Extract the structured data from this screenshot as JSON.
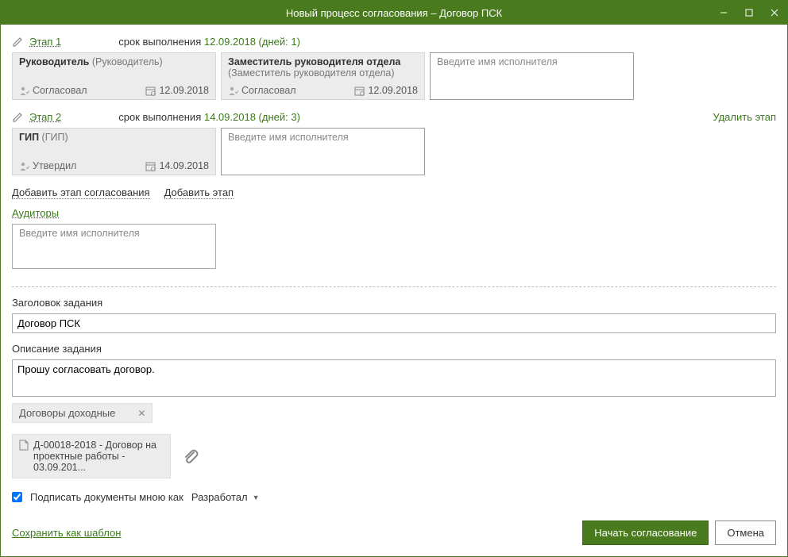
{
  "titlebar": {
    "title": "Новый процесс согласования – Договор ПСК"
  },
  "stages": [
    {
      "label": "Этап 1",
      "deadline_prefix": "срок выполнения ",
      "deadline_date": "12.09.2018",
      "deadline_days": " (дней: 1)",
      "delete_label": "",
      "cards": [
        {
          "role": "Руководитель",
          "subrole": "(Руководитель)",
          "status": "Согласовал",
          "date": "12.09.2018"
        },
        {
          "role": "Заместитель руководителя отдела",
          "subrole": "(Заместитель руководителя отдела)",
          "status": "Согласовал",
          "date": "12.09.2018"
        }
      ],
      "placeholder": "Введите имя исполнителя"
    },
    {
      "label": "Этап 2",
      "deadline_prefix": "срок выполнения ",
      "deadline_date": "14.09.2018",
      "deadline_days": " (дней: 3)",
      "delete_label": "Удалить этап",
      "cards": [
        {
          "role": "ГИП",
          "subrole": "(ГИП)",
          "status": "Утвердил",
          "date": "14.09.2018"
        }
      ],
      "placeholder": "Введите имя исполнителя"
    }
  ],
  "add_stage": {
    "approval": "Добавить этап согласования",
    "plain": "Добавить этап"
  },
  "auditors": {
    "label": "Аудиторы",
    "placeholder": "Введите имя исполнителя"
  },
  "task_title": {
    "label": "Заголовок задания",
    "value": "Договор ПСК"
  },
  "task_desc": {
    "label": "Описание задания",
    "value": "Прошу согласовать договор."
  },
  "tag": {
    "label": "Договоры доходные"
  },
  "attachment": {
    "name": "Д-00018-2018 - Договор на проектные работы - 03.09.201..."
  },
  "sign": {
    "label": "Подписать документы мною как",
    "role": "Разработал"
  },
  "footer": {
    "save_template": "Сохранить как шаблон",
    "start": "Начать согласование",
    "cancel": "Отмена"
  }
}
